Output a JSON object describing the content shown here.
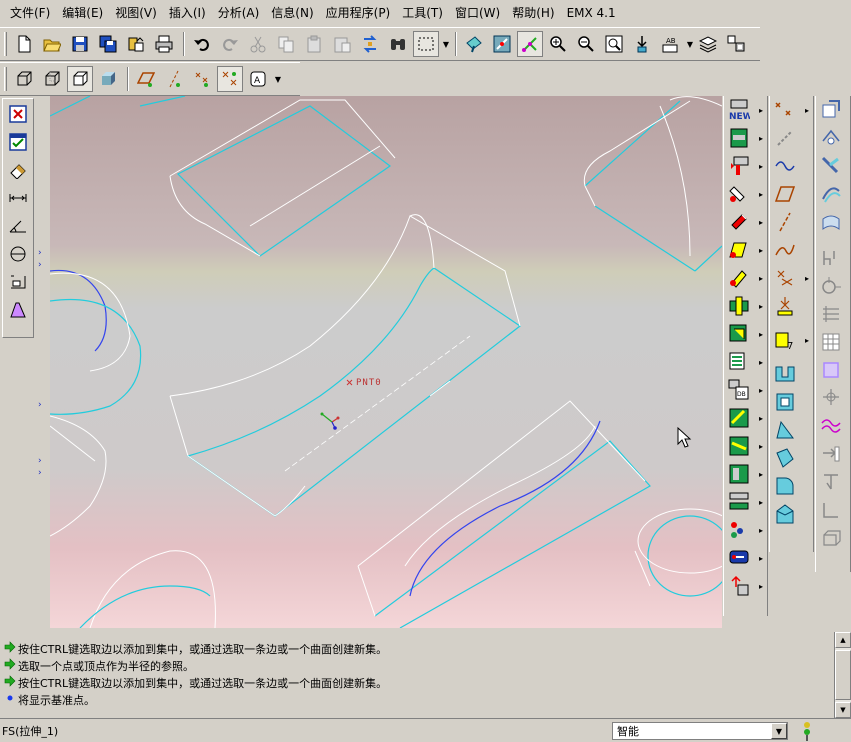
{
  "menubar": {
    "items": [
      {
        "label": "文件(F)"
      },
      {
        "label": "编辑(E)"
      },
      {
        "label": "视图(V)"
      },
      {
        "label": "插入(I)"
      },
      {
        "label": "分析(A)"
      },
      {
        "label": "信息(N)"
      },
      {
        "label": "应用程序(P)"
      },
      {
        "label": "工具(T)"
      },
      {
        "label": "窗口(W)"
      },
      {
        "label": "帮助(H)"
      },
      {
        "label": "EMX 4.1"
      }
    ]
  },
  "viewport": {
    "datum_point_label": "PNT0"
  },
  "messages": [
    {
      "icon": "green-arrow-icon",
      "text": "按住CTRL键选取边以添加到集中，或通过选取一条边或一个曲面创建新集。"
    },
    {
      "icon": "green-arrow-icon",
      "text": "选取一个点或顶点作为半径的参照。"
    },
    {
      "icon": "green-arrow-icon",
      "text": "按住CTRL键选取边以添加到集中，或通过选取一条边或一个曲面创建新集。"
    },
    {
      "icon": "blue-dot-icon",
      "text": "将显示基准点。"
    }
  ],
  "statusbar": {
    "feature_text": "FS(拉伸_1)",
    "filter_value": "智能"
  },
  "colors": {
    "ui_gray": "#d4d0c8",
    "edge_cyan": "#22ccdd",
    "curve_blue": "#3344ee",
    "edge_white": "#ffffff"
  }
}
